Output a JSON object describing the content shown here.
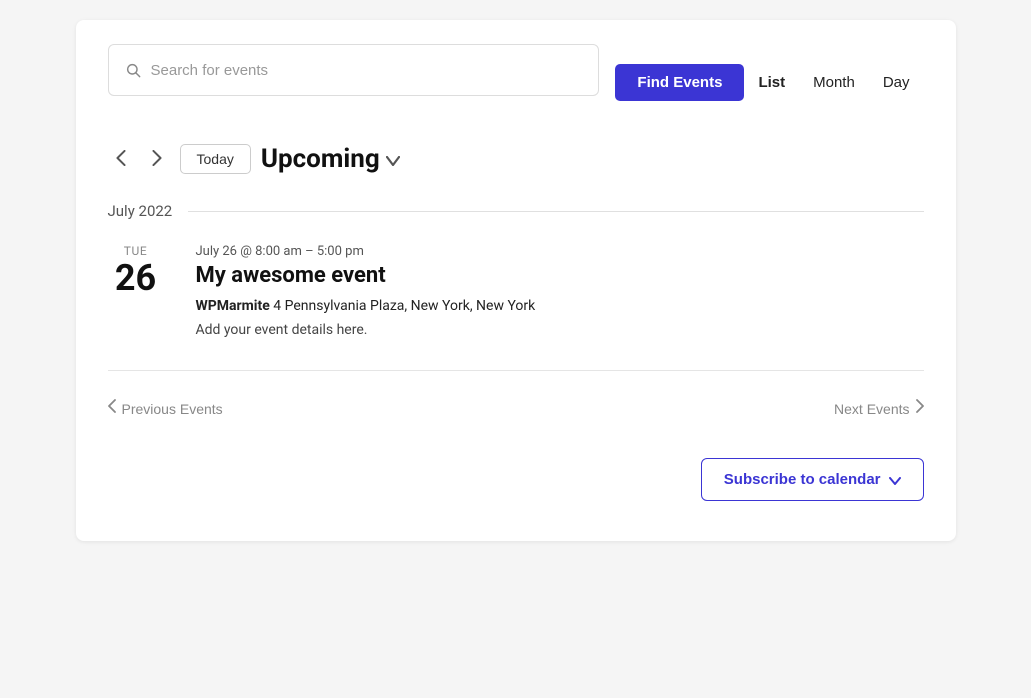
{
  "header": {
    "search_placeholder": "Search for events",
    "find_events_label": "Find Events",
    "views": [
      {
        "id": "list",
        "label": "List",
        "active": true
      },
      {
        "id": "month",
        "label": "Month",
        "active": false
      },
      {
        "id": "day",
        "label": "Day",
        "active": false
      }
    ]
  },
  "nav": {
    "today_label": "Today",
    "upcoming_label": "Upcoming"
  },
  "month_section": {
    "label": "July 2022"
  },
  "event": {
    "day_name": "TUE",
    "day_num": "26",
    "time": "July 26 @ 8:00 am – 5:00 pm",
    "title": "My awesome event",
    "location_name": "WPMarmite",
    "location_address": " 4 Pennsylvania Plaza, New York, New York",
    "description": "Add your event details here."
  },
  "pagination": {
    "prev_label": "Previous Events",
    "next_label": "Next Events"
  },
  "subscribe": {
    "label": "Subscribe to calendar"
  },
  "icons": {
    "search": "🔍",
    "chevron_down": "∨",
    "arrow_left": "‹",
    "arrow_right": "›",
    "chevron_down_small": "⌄"
  }
}
